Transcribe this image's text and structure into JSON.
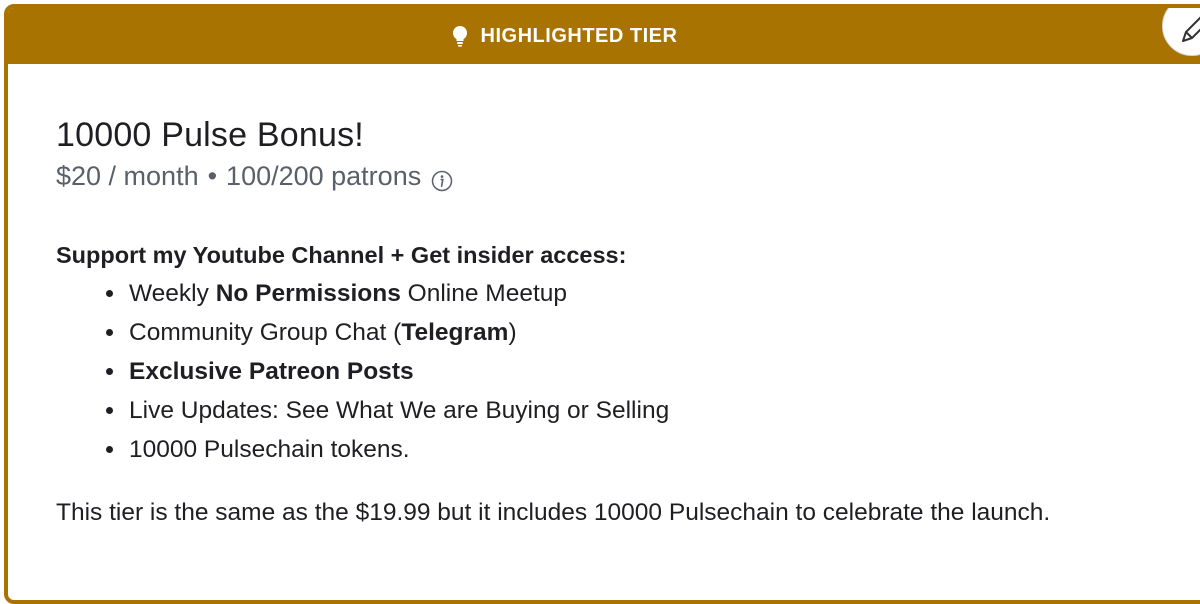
{
  "header": {
    "label": "HIGHLIGHTED TIER",
    "icon": "lightbulb-icon",
    "color": "#a87300"
  },
  "edit_button": {
    "icon": "pencil-icon"
  },
  "tier": {
    "title": "10000 Pulse Bonus!",
    "price": "$20 / month",
    "separator": "•",
    "patrons": "100/200 patrons",
    "info_icon": "info-icon",
    "description_heading": "Support my Youtube Channel + Get insider access:",
    "perks": [
      {
        "pre": "Weekly ",
        "bold": "No Permissions",
        "post": " Online Meetup"
      },
      {
        "pre": "Community Group Chat (",
        "bold": "Telegram",
        "post": ")"
      },
      {
        "pre": "",
        "bold": "Exclusive Patreon Posts",
        "post": ""
      },
      {
        "pre": "Live Updates: See What We are Buying or Selling",
        "bold": "",
        "post": ""
      },
      {
        "pre": "10000 Pulsechain tokens.",
        "bold": "",
        "post": ""
      }
    ],
    "note": "This tier is the same as the $19.99 but it includes 10000 Pulsechain to celebrate the launch."
  }
}
